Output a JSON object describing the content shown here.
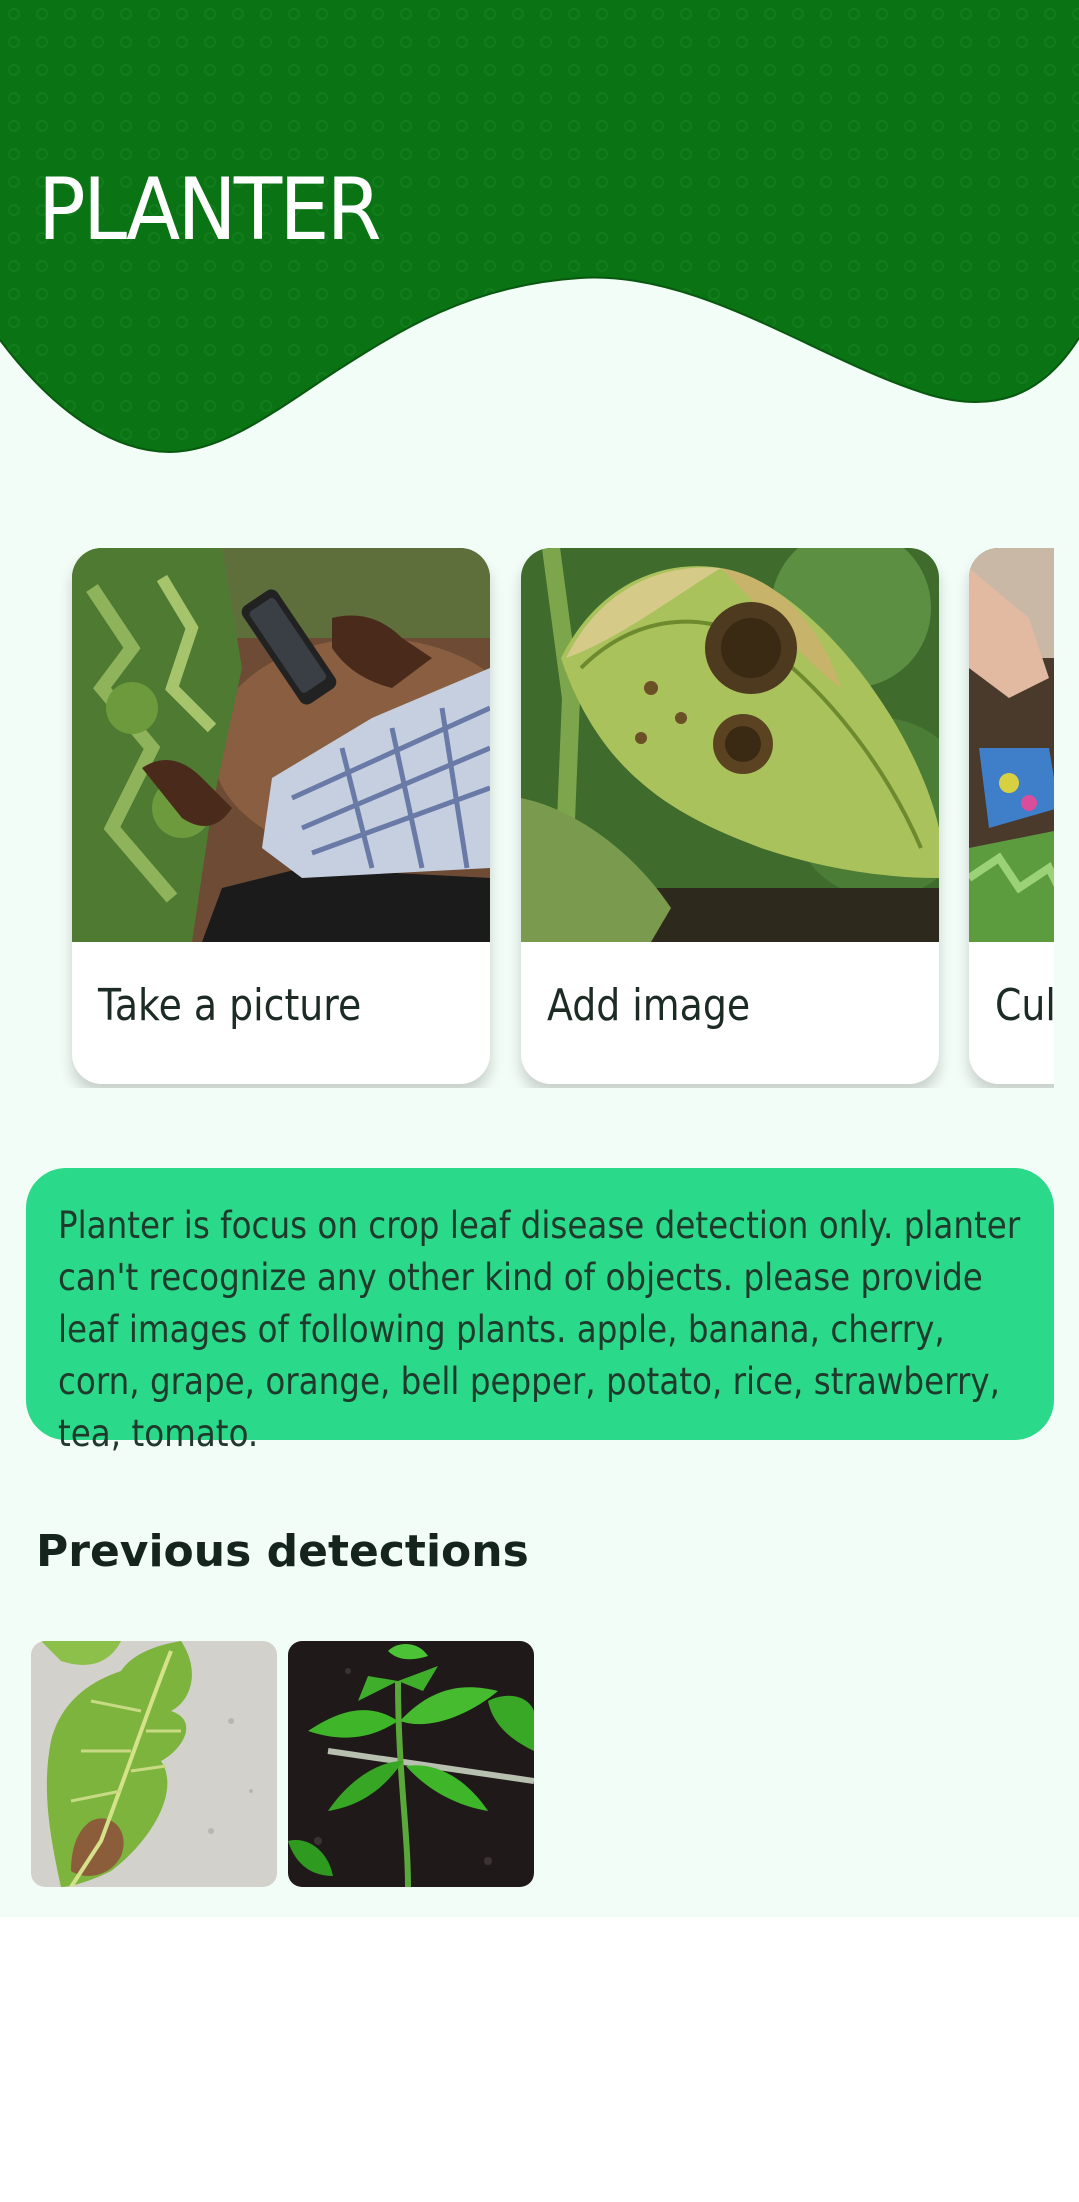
{
  "app": {
    "title": "PLANTER",
    "brand_color": "#0a7414",
    "accent_color": "#2ad989",
    "background_color": "#f3fdf7"
  },
  "actions": [
    {
      "label": "Take a picture",
      "image": "hand holding phone over tomato plants"
    },
    {
      "label": "Add image",
      "image": "diseased leaf close-up"
    },
    {
      "label": "Cul",
      "image": "gloved hands tending plants"
    }
  ],
  "info": {
    "text": "Planter is focus on crop leaf disease detection only. planter can't recognize any other kind of objects. please provide leaf images of following plants. apple, banana, cherry, corn, grape, orange, bell pepper, potato, rice, strawberry, tea, tomato."
  },
  "history": {
    "title": "Previous detections",
    "items": [
      {
        "image": "yellowing leaf on concrete"
      },
      {
        "image": "tomato seedling in soil"
      }
    ]
  }
}
